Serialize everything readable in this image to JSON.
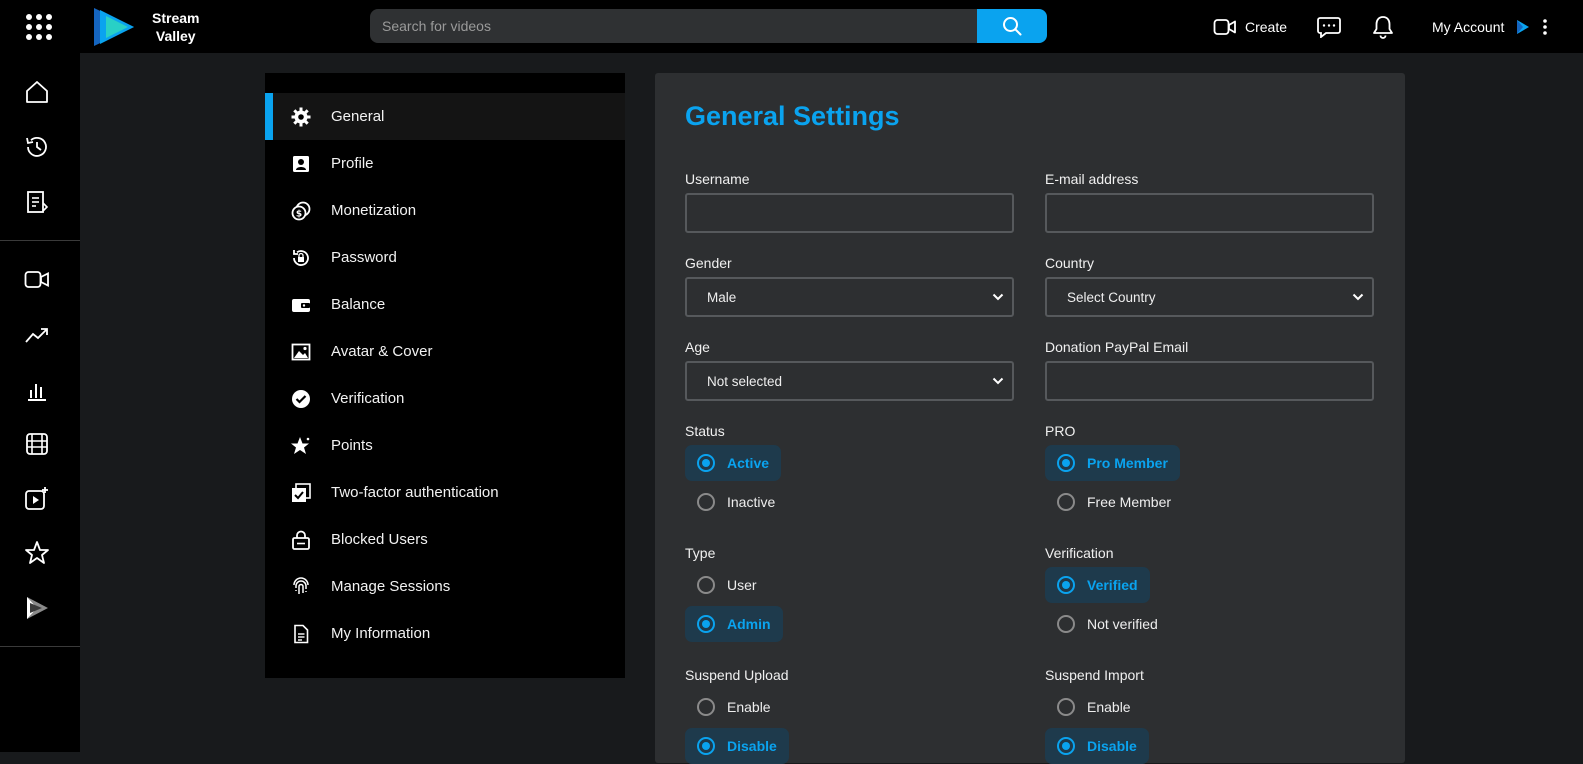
{
  "brand": {
    "name_line1": "Stream",
    "name_line2": "Valley",
    "accent": "#0aa3ef"
  },
  "header": {
    "search_placeholder": "Search for videos",
    "create_label": "Create",
    "account_label": "My Account",
    "icons": [
      "apps-grid-icon",
      "search-icon",
      "video-camera-icon",
      "message-icon",
      "bell-icon",
      "kebab-menu-icon"
    ]
  },
  "leftnav": {
    "icons": [
      "home-icon",
      "history-icon",
      "clipboard-icon",
      "video-camera-icon",
      "trending-icon",
      "chart-bars-icon",
      "film-icon",
      "add-video-icon",
      "star-icon",
      "play-store-icon"
    ]
  },
  "settings_menu": {
    "items": [
      {
        "label": "General",
        "icon": "gear-icon"
      },
      {
        "label": "Profile",
        "icon": "profile-card-icon"
      },
      {
        "label": "Monetization",
        "icon": "coins-icon"
      },
      {
        "label": "Password",
        "icon": "lock-reset-icon"
      },
      {
        "label": "Balance",
        "icon": "wallet-icon"
      },
      {
        "label": "Avatar & Cover",
        "icon": "image-icon"
      },
      {
        "label": "Verification",
        "icon": "check-circle-icon"
      },
      {
        "label": "Points",
        "icon": "star-sparkle-icon"
      },
      {
        "label": "Two-factor authentication",
        "icon": "checklist-icon"
      },
      {
        "label": "Blocked Users",
        "icon": "lock-icon"
      },
      {
        "label": "Manage Sessions",
        "icon": "fingerprint-icon"
      },
      {
        "label": "My Information",
        "icon": "document-icon"
      }
    ]
  },
  "form": {
    "title": "General Settings",
    "username_label": "Username",
    "username_value": "",
    "email_label": "E-mail address",
    "email_value": "",
    "gender_label": "Gender",
    "gender_value": "Male",
    "country_label": "Country",
    "country_value": "Select Country",
    "age_label": "Age",
    "age_value": "Not selected",
    "paypal_label": "Donation PayPal Email",
    "paypal_value": "",
    "status_label": "Status",
    "status_options": [
      "Active",
      "Inactive"
    ],
    "status_selected": "Active",
    "pro_label": "PRO",
    "pro_options": [
      "Pro Member",
      "Free Member"
    ],
    "pro_selected": "Pro Member",
    "type_label": "Type",
    "type_options": [
      "User",
      "Admin"
    ],
    "type_selected": "Admin",
    "verification_label": "Verification",
    "verification_options": [
      "Verified",
      "Not verified"
    ],
    "verification_selected": "Verified",
    "suspend_upload_label": "Suspend Upload",
    "suspend_upload_options": [
      "Enable",
      "Disable"
    ],
    "suspend_upload_selected": "Disable",
    "suspend_import_label": "Suspend Import",
    "suspend_import_options": [
      "Enable",
      "Disable"
    ],
    "suspend_import_selected": "Disable"
  }
}
